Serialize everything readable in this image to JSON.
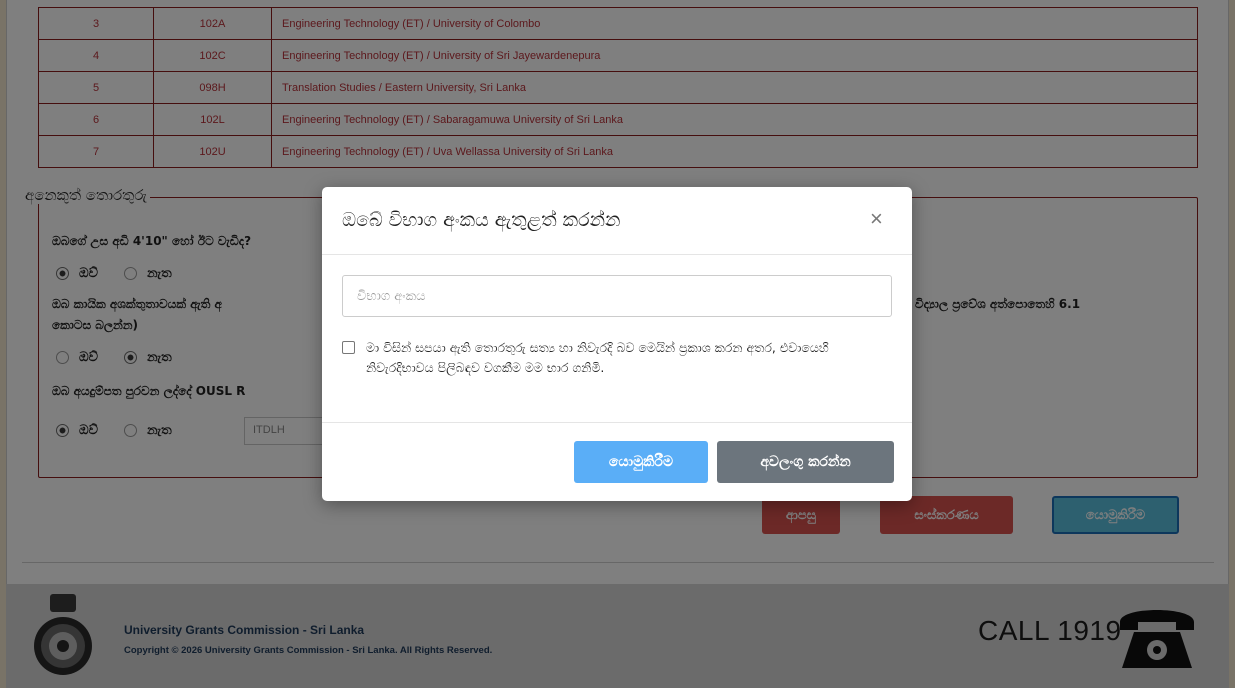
{
  "table": {
    "rows": [
      {
        "no": "3",
        "code": "102A",
        "course": "Engineering Technology (ET) / University of Colombo"
      },
      {
        "no": "4",
        "code": "102C",
        "course": "Engineering Technology (ET) / University of Sri Jayewardenepura"
      },
      {
        "no": "5",
        "code": "098H",
        "course": "Translation Studies / Eastern University, Sri Lanka"
      },
      {
        "no": "6",
        "code": "102L",
        "course": "Engineering Technology (ET) / Sabaragamuwa University of Sri Lanka"
      },
      {
        "no": "7",
        "code": "102U",
        "course": "Engineering Technology (ET) / Uva Wellassa University of Sri Lanka"
      }
    ]
  },
  "info": {
    "legend": "අනෙකුත් තොරතුරු",
    "q1": "ඔබගේ උස අඩි 4'10\" හෝ ඊට වැඩිද?",
    "q2a": "ඔබ කායික අශක්තුතාවයක් ඇති අ",
    "q2b": "විද්‍යාල ප්‍රවේශ අත්පොතෙහි 6.1",
    "q2c": "කොටස බලන්න)",
    "q3": "ඔබ අයදුම්පත පුරවන ලද්දේ OUSL R",
    "yes": "ඔව්",
    "no": "නැත",
    "rc_value": "ITDLH"
  },
  "buttons": {
    "back": "ආපසු",
    "edit": "සංස්කරණය",
    "submit": "යොමුකිරීම"
  },
  "footer": {
    "title": "University Grants Commission - Sri Lanka",
    "copyright": "Copyright © 2026 University Grants Commission - Sri Lanka. All Rights Reserved.",
    "call": "CALL 1919"
  },
  "modal": {
    "title": "ඔබේ විභාග අංකය ඇතුළත් කරන්න",
    "close": "×",
    "input_placeholder": "විභාග අංකය",
    "checkbox_text": "මා විසින් සපයා ඇති තොරතුරු සත්‍ය හා නිවැරදි බව මෙයින් ප්‍රකාශ කරන අතර, එවායෙහි නිවැරදිභාවය පිලිබඳව වගකීම මම භාර ගනිමි.",
    "submit": "යොමුකිරීම",
    "cancel": "අවලංගු කරන්න"
  },
  "colors": {
    "accent_red": "#d9534f",
    "accent_blue": "#5aaef7",
    "table_border": "#8a1c1c"
  }
}
